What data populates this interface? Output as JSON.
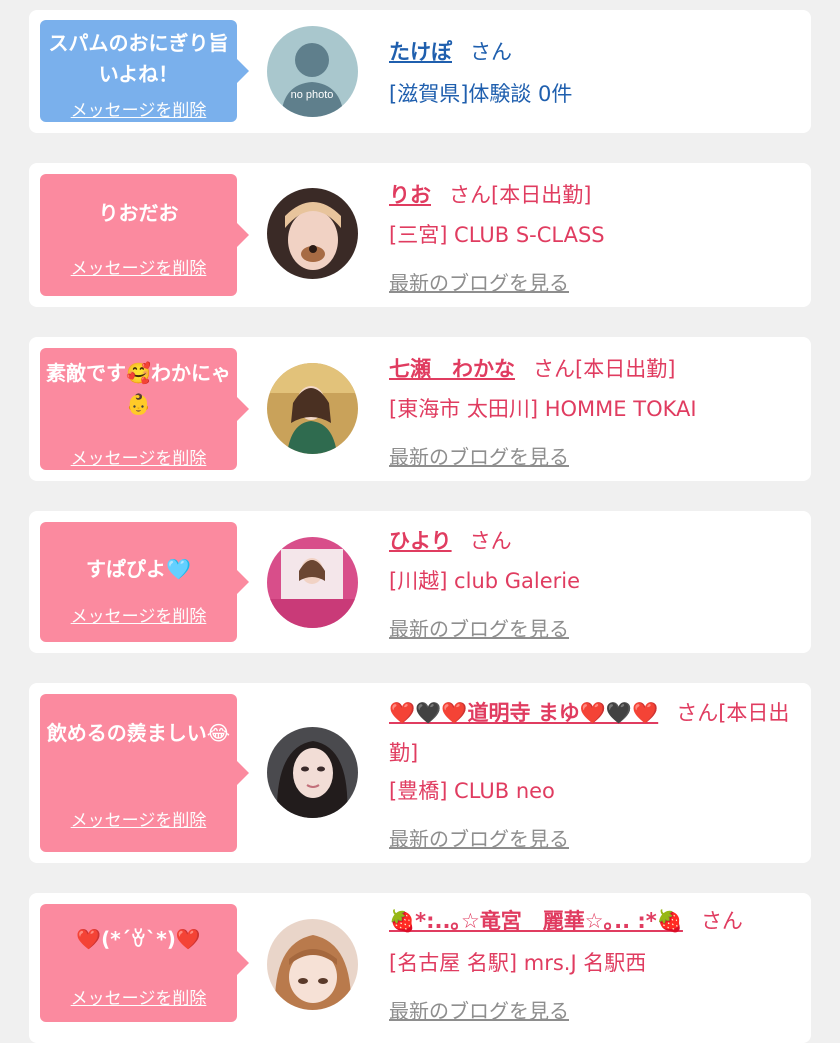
{
  "items": [
    {
      "message": "スパムのおにぎり旨いよね！",
      "delete_label": "メッセージを削除",
      "avatar_text": "no photo",
      "name": "たけぽ",
      "suffix": "さん",
      "location": "[滋賀県]体験談 0件"
    },
    {
      "message": "りおだお",
      "delete_label": "メッセージを削除",
      "name": "りお",
      "suffix": "さん[本日出勤]",
      "location": "[三宮] CLUB S-CLASS",
      "blog": "最新のブログを見る"
    },
    {
      "message": "素敵です🥰わかにゃ👶",
      "delete_label": "メッセージを削除",
      "name": "七瀬　わかな",
      "suffix": "さん[本日出勤]",
      "location": "[東海市 太田川] HOMME TOKAI",
      "blog": "最新のブログを見る"
    },
    {
      "message": "すぱぴよ🩵",
      "delete_label": "メッセージを削除",
      "name": "ひより",
      "suffix": "さん",
      "location": "[川越] club Galerie",
      "blog": "最新のブログを見る"
    },
    {
      "message": "飲めるの羨ましい😂",
      "delete_label": "メッセージを削除",
      "name": "❤️🖤❤️道明寺 まゆ❤️🖤❤️",
      "suffix": "さん[本日出勤]",
      "location": "[豊橋] CLUB neo",
      "blog": "最新のブログを見る"
    },
    {
      "message": "❤️(*´ꈊ`*)❤️",
      "delete_label": "メッセージを削除",
      "name": "🍓*:..｡☆竜宮　麗華☆｡.. :*🍓",
      "suffix": "さん",
      "location": "[名古屋 名駅] mrs.J 名駅西",
      "blog": "最新のブログを見る"
    }
  ]
}
